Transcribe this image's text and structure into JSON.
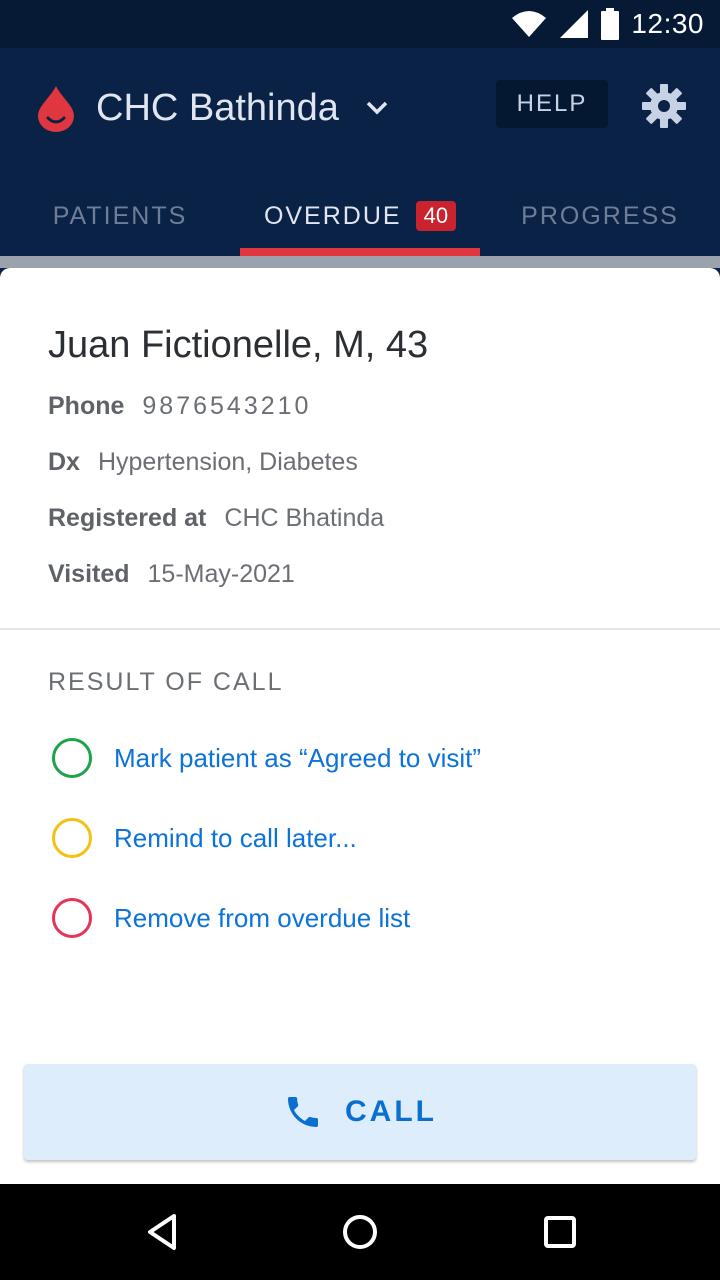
{
  "status_bar": {
    "time": "12:30",
    "icons": [
      "wifi-icon",
      "signal-icon",
      "battery-icon"
    ]
  },
  "app_bar": {
    "facility_name": "CHC Bathinda",
    "help_label": "HELP",
    "tabs": [
      {
        "label": "PATIENTS",
        "active": false
      },
      {
        "label": "OVERDUE",
        "badge": "40",
        "active": true
      },
      {
        "label": "PROGRESS",
        "active": false
      }
    ]
  },
  "patient": {
    "name_line": "Juan Fictionelle, M, 43",
    "fields": [
      {
        "label": "Phone",
        "value": "9876543210"
      },
      {
        "label": "Dx",
        "value": "Hypertension, Diabetes"
      },
      {
        "label": "Registered at",
        "value": "CHC Bhatinda"
      },
      {
        "label": "Visited",
        "value": "15-May-2021"
      }
    ]
  },
  "result_of_call": {
    "title": "RESULT OF CALL",
    "options": [
      {
        "label": "Mark patient as “Agreed to visit”",
        "color": "#1fa34a"
      },
      {
        "label": "Remind to call later...",
        "color": "#f5c013"
      },
      {
        "label": "Remove from overdue list",
        "color": "#e5335a"
      }
    ]
  },
  "call_button": {
    "label": "CALL",
    "icon": "phone-icon"
  },
  "colors": {
    "app_bar": "#0b2247",
    "accent_red": "#e0363f",
    "link_blue": "#0b73d9",
    "call_bg": "#deedfb"
  }
}
